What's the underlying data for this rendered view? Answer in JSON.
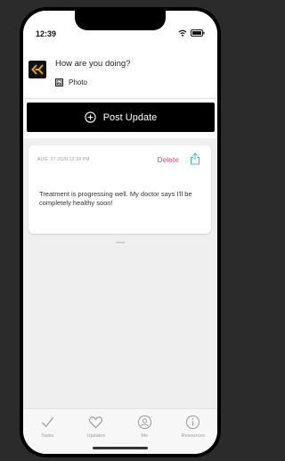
{
  "status_bar": {
    "time": "12:39"
  },
  "composer": {
    "prompt": "How are you doing?",
    "photo_label": "Photo"
  },
  "post_button": {
    "label": "Post Update"
  },
  "update_card": {
    "date": "AUG, 27 2020 12:39 PM",
    "delete_label": "Delete",
    "text": "Treatment is progressing well. My doctor says I'll be completely healthy soon!"
  },
  "tabs": [
    {
      "label": "Tasks",
      "icon": "check-icon"
    },
    {
      "label": "Updates",
      "icon": "heart-icon"
    },
    {
      "label": "Me",
      "icon": "profile-icon"
    },
    {
      "label": "Resources",
      "icon": "info-icon"
    }
  ],
  "colors": {
    "accent_pink": "#e94a7a",
    "accent_teal": "#3cc6b0",
    "logo_gold": "#e5a51b"
  }
}
